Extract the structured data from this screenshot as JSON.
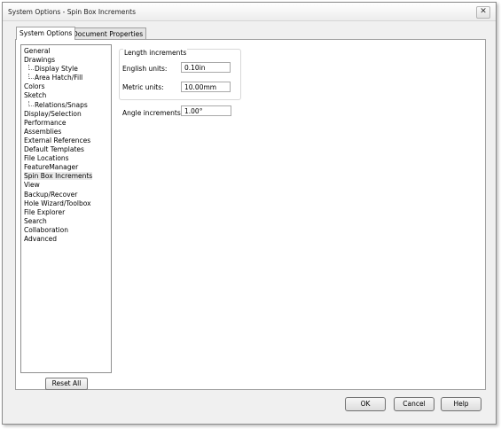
{
  "window": {
    "title": "System Options - Spin Box Increments",
    "close_symbol": "✕"
  },
  "tabs": [
    {
      "label": "System Options",
      "active": true
    },
    {
      "label": "Document Properties",
      "active": false
    }
  ],
  "tree": {
    "items": [
      {
        "label": "General",
        "level": 0
      },
      {
        "label": "Drawings",
        "level": 0
      },
      {
        "label": "Display Style",
        "level": 1
      },
      {
        "label": "Area Hatch/Fill",
        "level": 1
      },
      {
        "label": "Colors",
        "level": 0
      },
      {
        "label": "Sketch",
        "level": 0
      },
      {
        "label": "Relations/Snaps",
        "level": 1
      },
      {
        "label": "Display/Selection",
        "level": 0
      },
      {
        "label": "Performance",
        "level": 0
      },
      {
        "label": "Assemblies",
        "level": 0
      },
      {
        "label": "External References",
        "level": 0
      },
      {
        "label": "Default Templates",
        "level": 0
      },
      {
        "label": "File Locations",
        "level": 0
      },
      {
        "label": "FeatureManager",
        "level": 0
      },
      {
        "label": "Spin Box Increments",
        "level": 0,
        "selected": true
      },
      {
        "label": "View",
        "level": 0
      },
      {
        "label": "Backup/Recover",
        "level": 0
      },
      {
        "label": "Hole Wizard/Toolbox",
        "level": 0
      },
      {
        "label": "File Explorer",
        "level": 0
      },
      {
        "label": "Search",
        "level": 0
      },
      {
        "label": "Collaboration",
        "level": 0
      },
      {
        "label": "Advanced",
        "level": 0
      }
    ]
  },
  "length_increments": {
    "title": "Length increments",
    "english_label": "English units:",
    "english_value": "0.10in",
    "metric_label": "Metric units:",
    "metric_value": "10.00mm"
  },
  "angle_increments": {
    "label": "Angle increments:",
    "value": "1.00°"
  },
  "buttons": {
    "reset": "Reset All",
    "ok": "OK",
    "cancel": "Cancel",
    "help": "Help"
  }
}
